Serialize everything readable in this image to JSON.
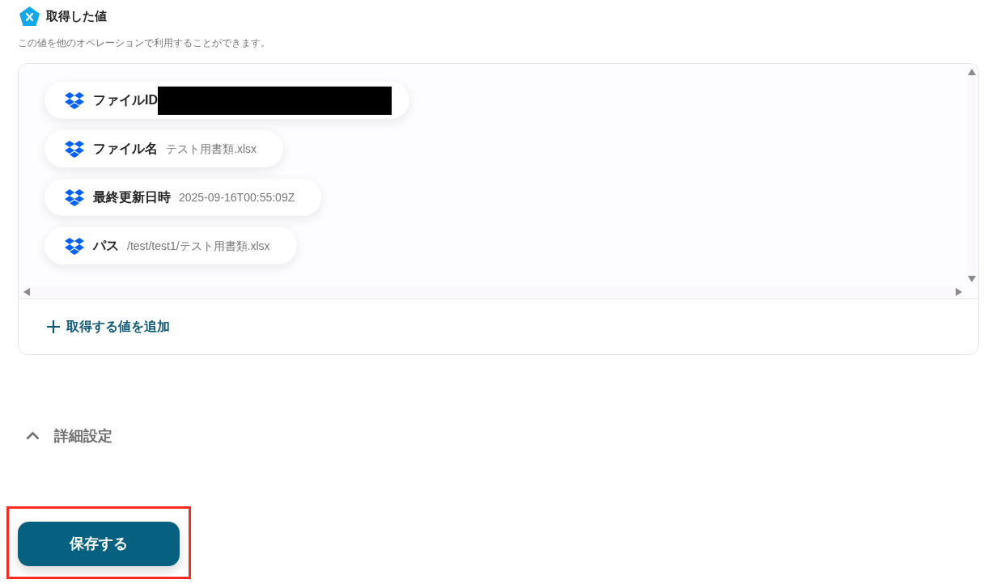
{
  "section": {
    "title": "取得した値",
    "description": "この値を他のオペレーションで利用することができます。"
  },
  "values": [
    {
      "label": "ファイルID",
      "redacted": true
    },
    {
      "label": "ファイル名",
      "value": "テスト用書類.xlsx",
      "redacted": false
    },
    {
      "label": "最終更新日時",
      "value": "2025-09-16T00:55:09Z",
      "redacted": false
    },
    {
      "label": "パス",
      "value": "/test/test1/テスト用書類.xlsx",
      "redacted": false
    }
  ],
  "add_button": {
    "label": "取得する値を追加"
  },
  "advanced_settings": {
    "label": "詳細設定"
  },
  "save_button": {
    "label": "保存する",
    "highlighted": true
  }
}
